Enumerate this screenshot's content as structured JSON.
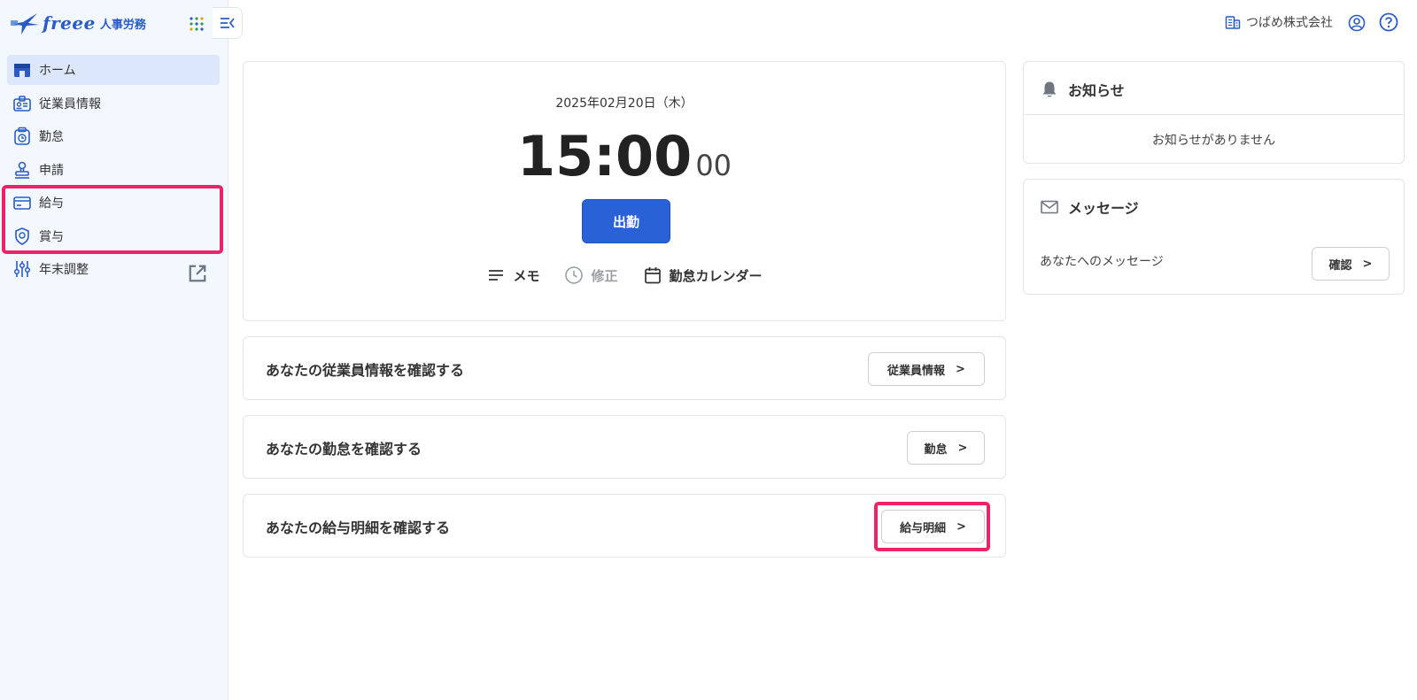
{
  "app": {
    "brand": "freee",
    "product": "人事労務"
  },
  "sidebar": {
    "items": [
      {
        "label": "ホーム",
        "icon": "home-icon",
        "active": true
      },
      {
        "label": "従業員情報",
        "icon": "employee-card-icon"
      },
      {
        "label": "勤怠",
        "icon": "timecard-icon"
      },
      {
        "label": "申請",
        "icon": "stamp-icon"
      },
      {
        "label": "給与",
        "icon": "salary-card-icon"
      },
      {
        "label": "賞与",
        "icon": "bonus-badge-icon"
      },
      {
        "label": "年末調整",
        "icon": "sliders-icon",
        "external": true
      }
    ]
  },
  "header": {
    "company": "つばめ株式会社"
  },
  "clock": {
    "date": "2025年02月20日（木）",
    "time": "15:00",
    "seconds": "00",
    "clock_in_label": "出勤",
    "actions": [
      {
        "label": "メモ",
        "icon": "memo-lines-icon"
      },
      {
        "label": "修正",
        "icon": "clock-icon",
        "disabled": true
      },
      {
        "label": "勤怠カレンダー",
        "icon": "calendar-icon"
      }
    ]
  },
  "links": [
    {
      "text": "あなたの従業員情報を確認する",
      "button": "従業員情報"
    },
    {
      "text": "あなたの勤怠を確認する",
      "button": "勤怠"
    },
    {
      "text": "あなたの給与明細を確認する",
      "button": "給与明細"
    }
  ],
  "notices": {
    "title": "お知らせ",
    "empty": "お知らせがありません"
  },
  "messages": {
    "title": "メッセージ",
    "text": "あなたへのメッセージ",
    "button": "確認"
  },
  "colors": {
    "accent": "#2962d6",
    "highlight": "#ee2266",
    "sidebar_bg": "#f3f7fe"
  }
}
